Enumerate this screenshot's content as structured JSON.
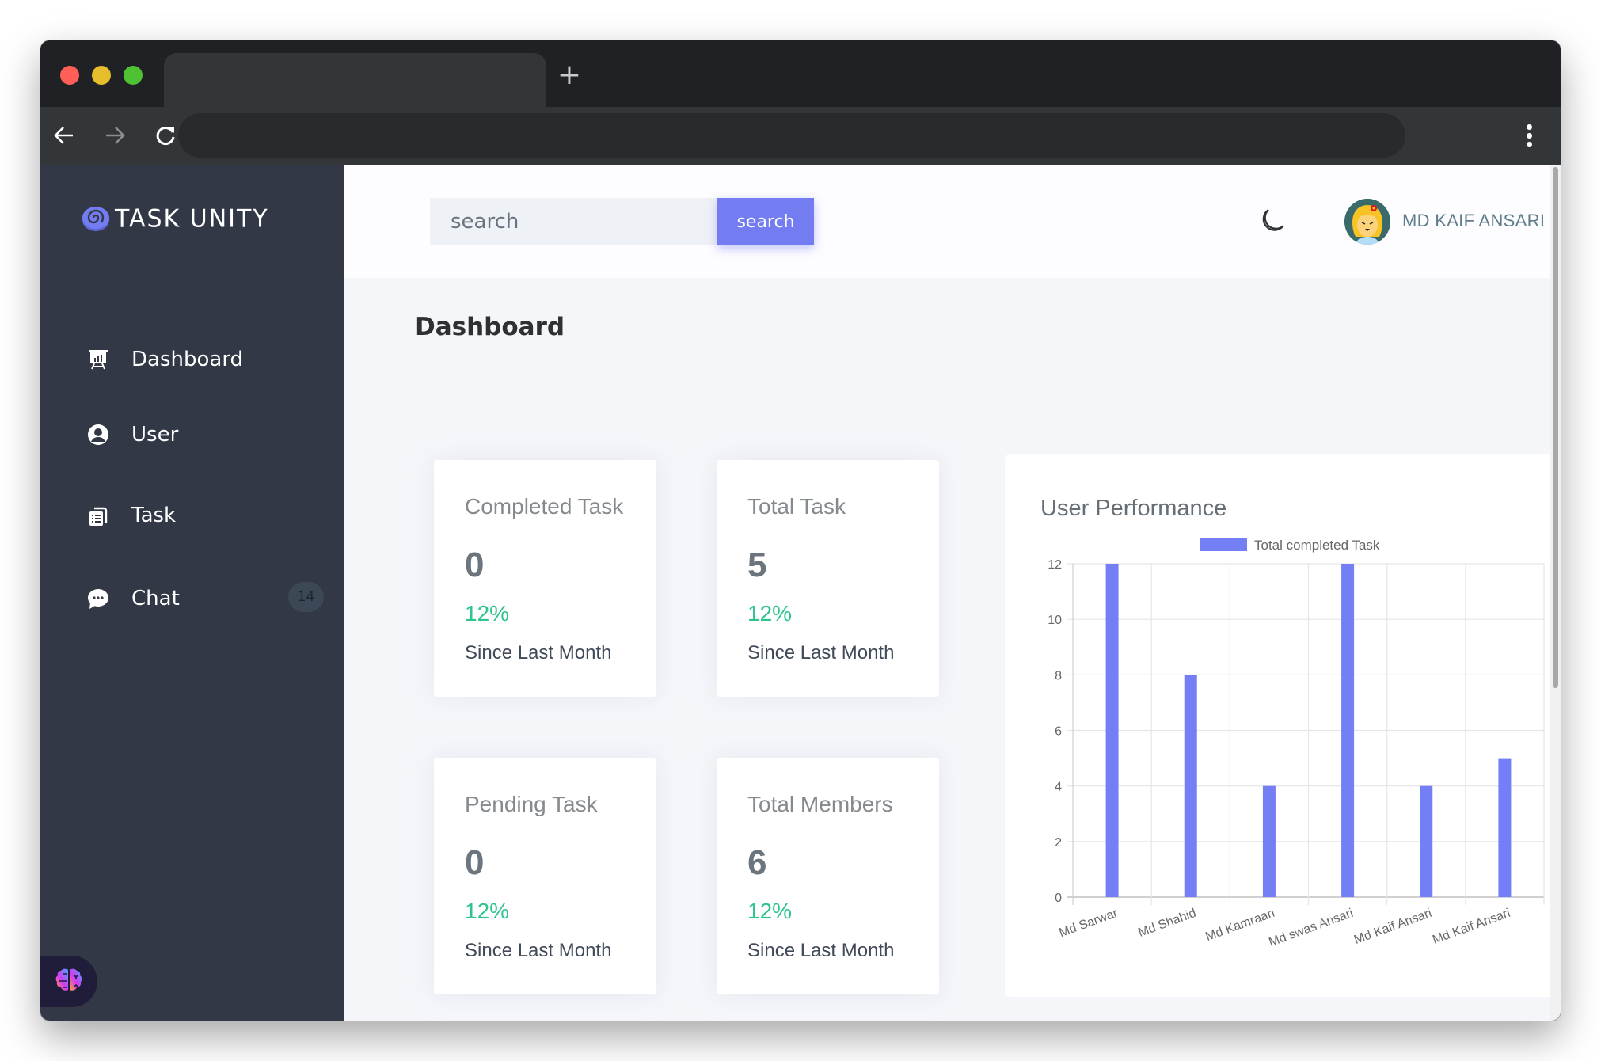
{
  "browser": {
    "tab_title": "",
    "new_tab_label": "+",
    "address": ""
  },
  "sidebar": {
    "logo_text": "TASK UNITY",
    "items": [
      {
        "label": "Dashboard",
        "icon": "presentation-chart-icon"
      },
      {
        "label": "User",
        "icon": "user-circle-icon"
      },
      {
        "label": "Task",
        "icon": "clipboard-list-icon"
      },
      {
        "label": "Chat",
        "icon": "chat-bubble-icon",
        "badge": "14"
      }
    ],
    "assistant_icon": "brain-icon"
  },
  "header": {
    "search_placeholder": "search",
    "search_value": "",
    "search_button": "search",
    "theme_icon": "moon-icon",
    "user_name": "MD KAIF ANSARI"
  },
  "main": {
    "page_title": "Dashboard",
    "cards": [
      {
        "title": "Completed Task",
        "value": "0",
        "pct": "12%",
        "since": "Since Last Month"
      },
      {
        "title": "Total Task",
        "value": "5",
        "pct": "12%",
        "since": "Since Last Month"
      },
      {
        "title": "Pending Task",
        "value": "0",
        "pct": "12%",
        "since": "Since Last Month"
      },
      {
        "title": "Total Members",
        "value": "6",
        "pct": "12%",
        "since": "Since Last Month"
      }
    ]
  },
  "colors": {
    "accent": "#737cf1",
    "bar": "#747ff5",
    "positive": "#2ec58c",
    "sidebar_bg": "#323846"
  },
  "chart_data": {
    "type": "bar",
    "title": "User Performance",
    "categories": [
      "Md Sarwar",
      "Md Shahid",
      "Md Kamraan",
      "Md swas Ansari",
      "Md Kaif Ansari",
      "Md Kaif Ansari"
    ],
    "series": [
      {
        "name": "Total completed Task",
        "values": [
          12,
          8,
          4,
          12,
          4,
          5
        ]
      }
    ],
    "xlabel": "",
    "ylabel": "",
    "ylim": [
      0,
      12
    ],
    "yticks": [
      0,
      2,
      4,
      6,
      8,
      10,
      12
    ],
    "grid": true,
    "legend_position": "top-center"
  }
}
